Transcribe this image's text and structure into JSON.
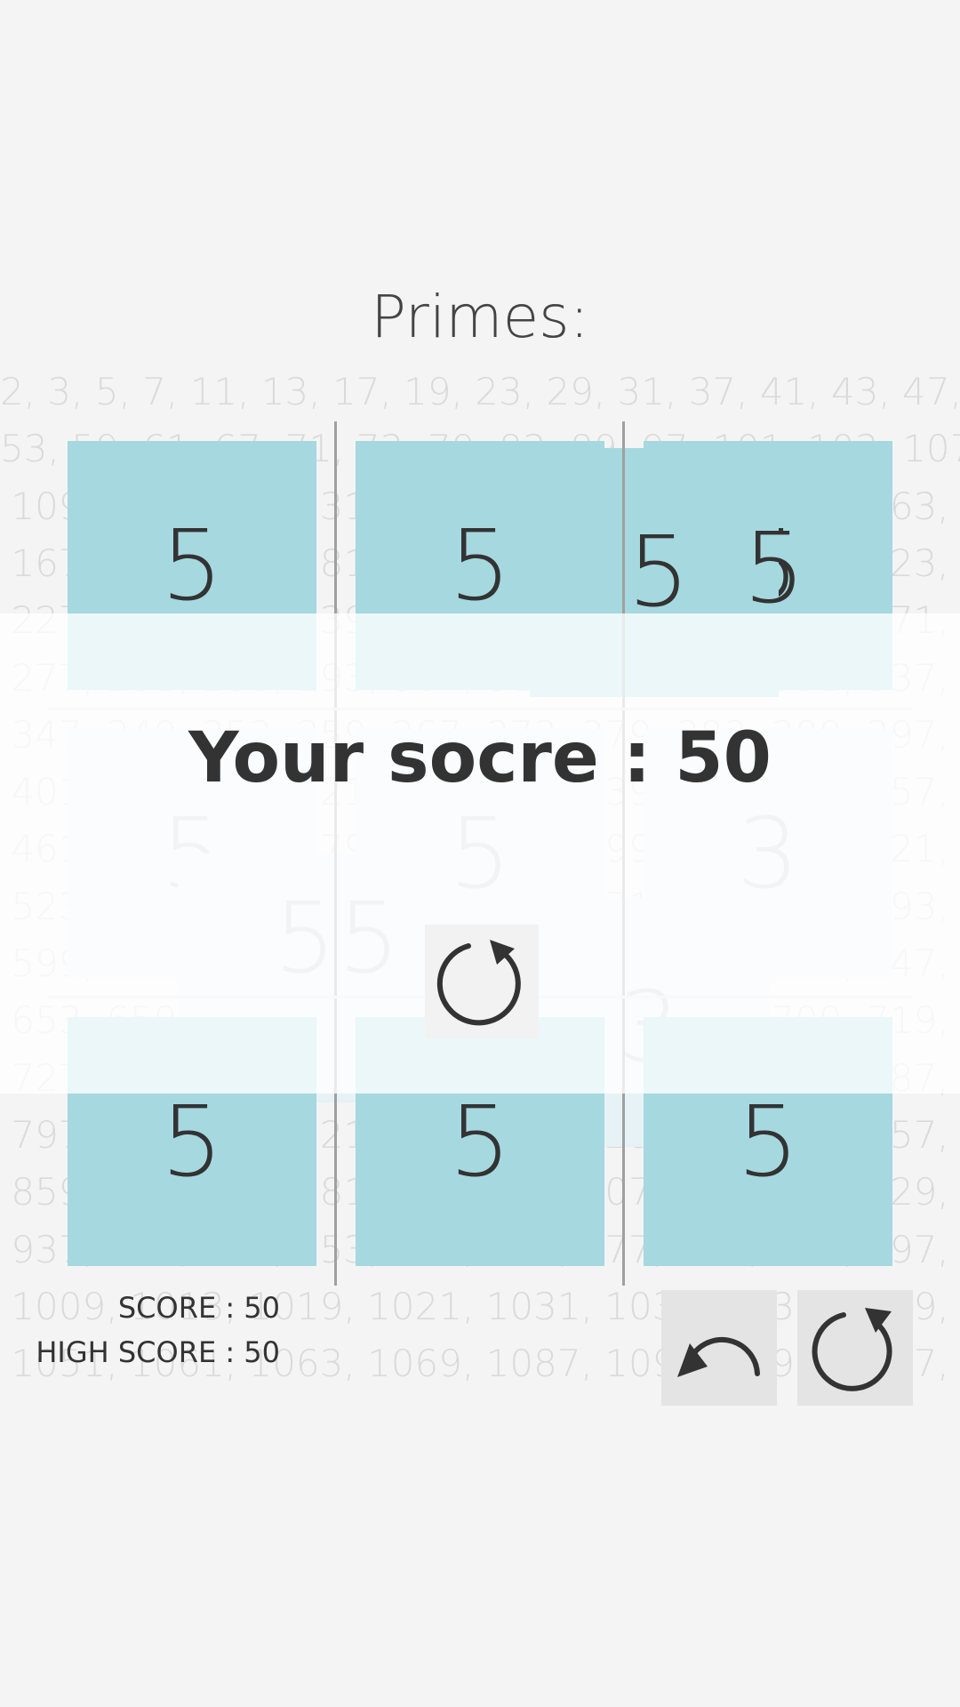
{
  "title": "Primes:",
  "prime_lines": [
    "2, 3, 5, 7, 11, 13, 17, 19, 23, 29, 31, 37, 41, 43, 47,",
    "53, 59, 61, 67, 71, 73, 79, 83, 89, 97, 101, 103, 107,",
    "109, 113, 127, 131, 137, 139, 149, 151, 157, 163,",
    "167, 173, 179, 181, 191, 193, 197, 199, 211, 223,",
    "227, 229, 233, 239, 241, 251, 257, 263, 269, 271,",
    "277, 281, 283, 293, 307, 311, 313, 317, 331, 337,",
    "347, 349, 353, 359, 367, 373, 379, 383, 389, 397,",
    "401, 409, 419, 421, 431, 433, 439, 443, 449, 457,",
    "461, 463, 467, 479, 487, 491, 499, 503, 509, 521,",
    "523, 541, 547, 557, 563, 569, 571, 577, 587, 593,",
    "599, 601, 607, 613, 617, 619, 631, 641, 643, 647,",
    "653, 659, 661, 673, 677, 683, 691, 701, 709, 719,",
    "727, 733, 739, 743, 751, 757, 761, 769, 773, 787,",
    "797, 809, 811, 821, 823, 827, 829, 839, 853, 857,",
    "859, 863, 877, 881, 883, 887, 907, 911, 919, 929,",
    "937, 941, 947, 953, 967, 971, 977, 983, 991, 997,",
    "1009, 1013, 1019, 1021, 1031, 1033, 1039, 1049,",
    "1051, 1061, 1063, 1069, 1087, 1091, 1093, 1097,"
  ],
  "board": {
    "top_row": [
      "5",
      "5",
      "5"
    ],
    "middle_row": [
      "5",
      "5",
      "3"
    ],
    "bottom_row": [
      "5",
      "5",
      "5"
    ],
    "floating": [
      "5",
      "5",
      "5",
      "3"
    ]
  },
  "game_over": {
    "score_text": "Your socre : 50"
  },
  "stats": {
    "score": "SCORE : 50",
    "high_score": "HIGH SCORE : 50"
  },
  "icons": {
    "restart": "restart-icon",
    "undo": "undo-icon",
    "redo": "redo-icon"
  },
  "colors": {
    "tile": "#a6d8df",
    "tile_faint": "#e6f2f5",
    "background": "#f4f4f4"
  }
}
